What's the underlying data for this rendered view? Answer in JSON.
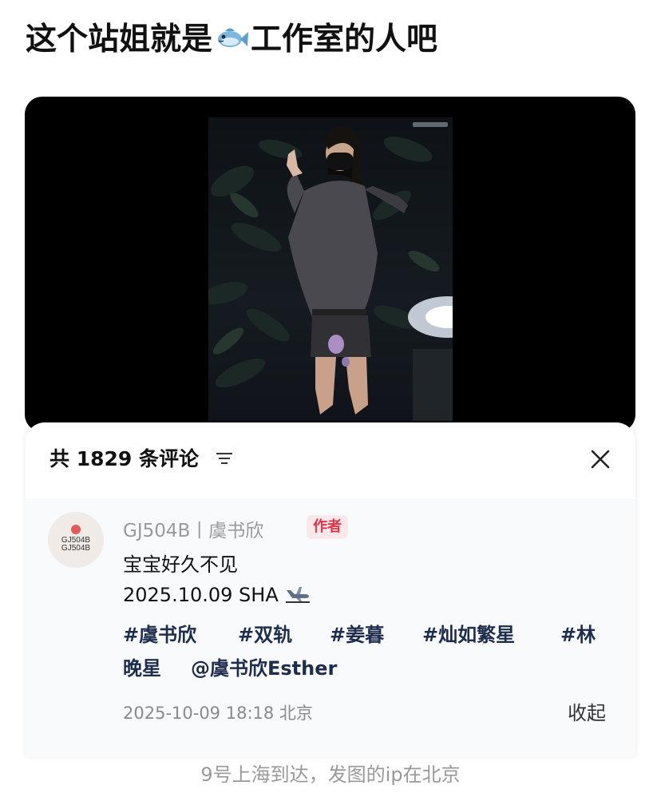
{
  "post": {
    "title_before": "这个站姐就是",
    "title_after": "工作室的人吧",
    "title_emoji": "fish-emoji"
  },
  "video": {
    "content": "video-frame"
  },
  "comments": {
    "header": "共 1829 条评论",
    "sort_icon": "sort-lines-icon",
    "close_icon": "close-icon",
    "items": [
      {
        "avatar_text_1": "GJ504B",
        "avatar_text_2": "GJ504B",
        "user": "GJ504B丨虞书欣",
        "badge": "作者",
        "line1": "宝宝好久不见",
        "line2": "2025.10.09 SHA",
        "line2_icon": "airplane-icon",
        "tags": [
          "#虞书欣",
          "#双轨",
          "#姜暮",
          "#灿如繁星",
          "#林",
          "晚星",
          "@虞书欣Esther"
        ],
        "meta": "2025-10-09 18:18 北京",
        "collapse": "收起"
      }
    ]
  },
  "caption": "9号上海到达，发图的ip在北京",
  "colors": {
    "badge_bg": "#fbe8ea",
    "badge_text": "#e0364a",
    "tag_text": "#1f2d4d",
    "avatar_dot": "#e35a5c"
  }
}
